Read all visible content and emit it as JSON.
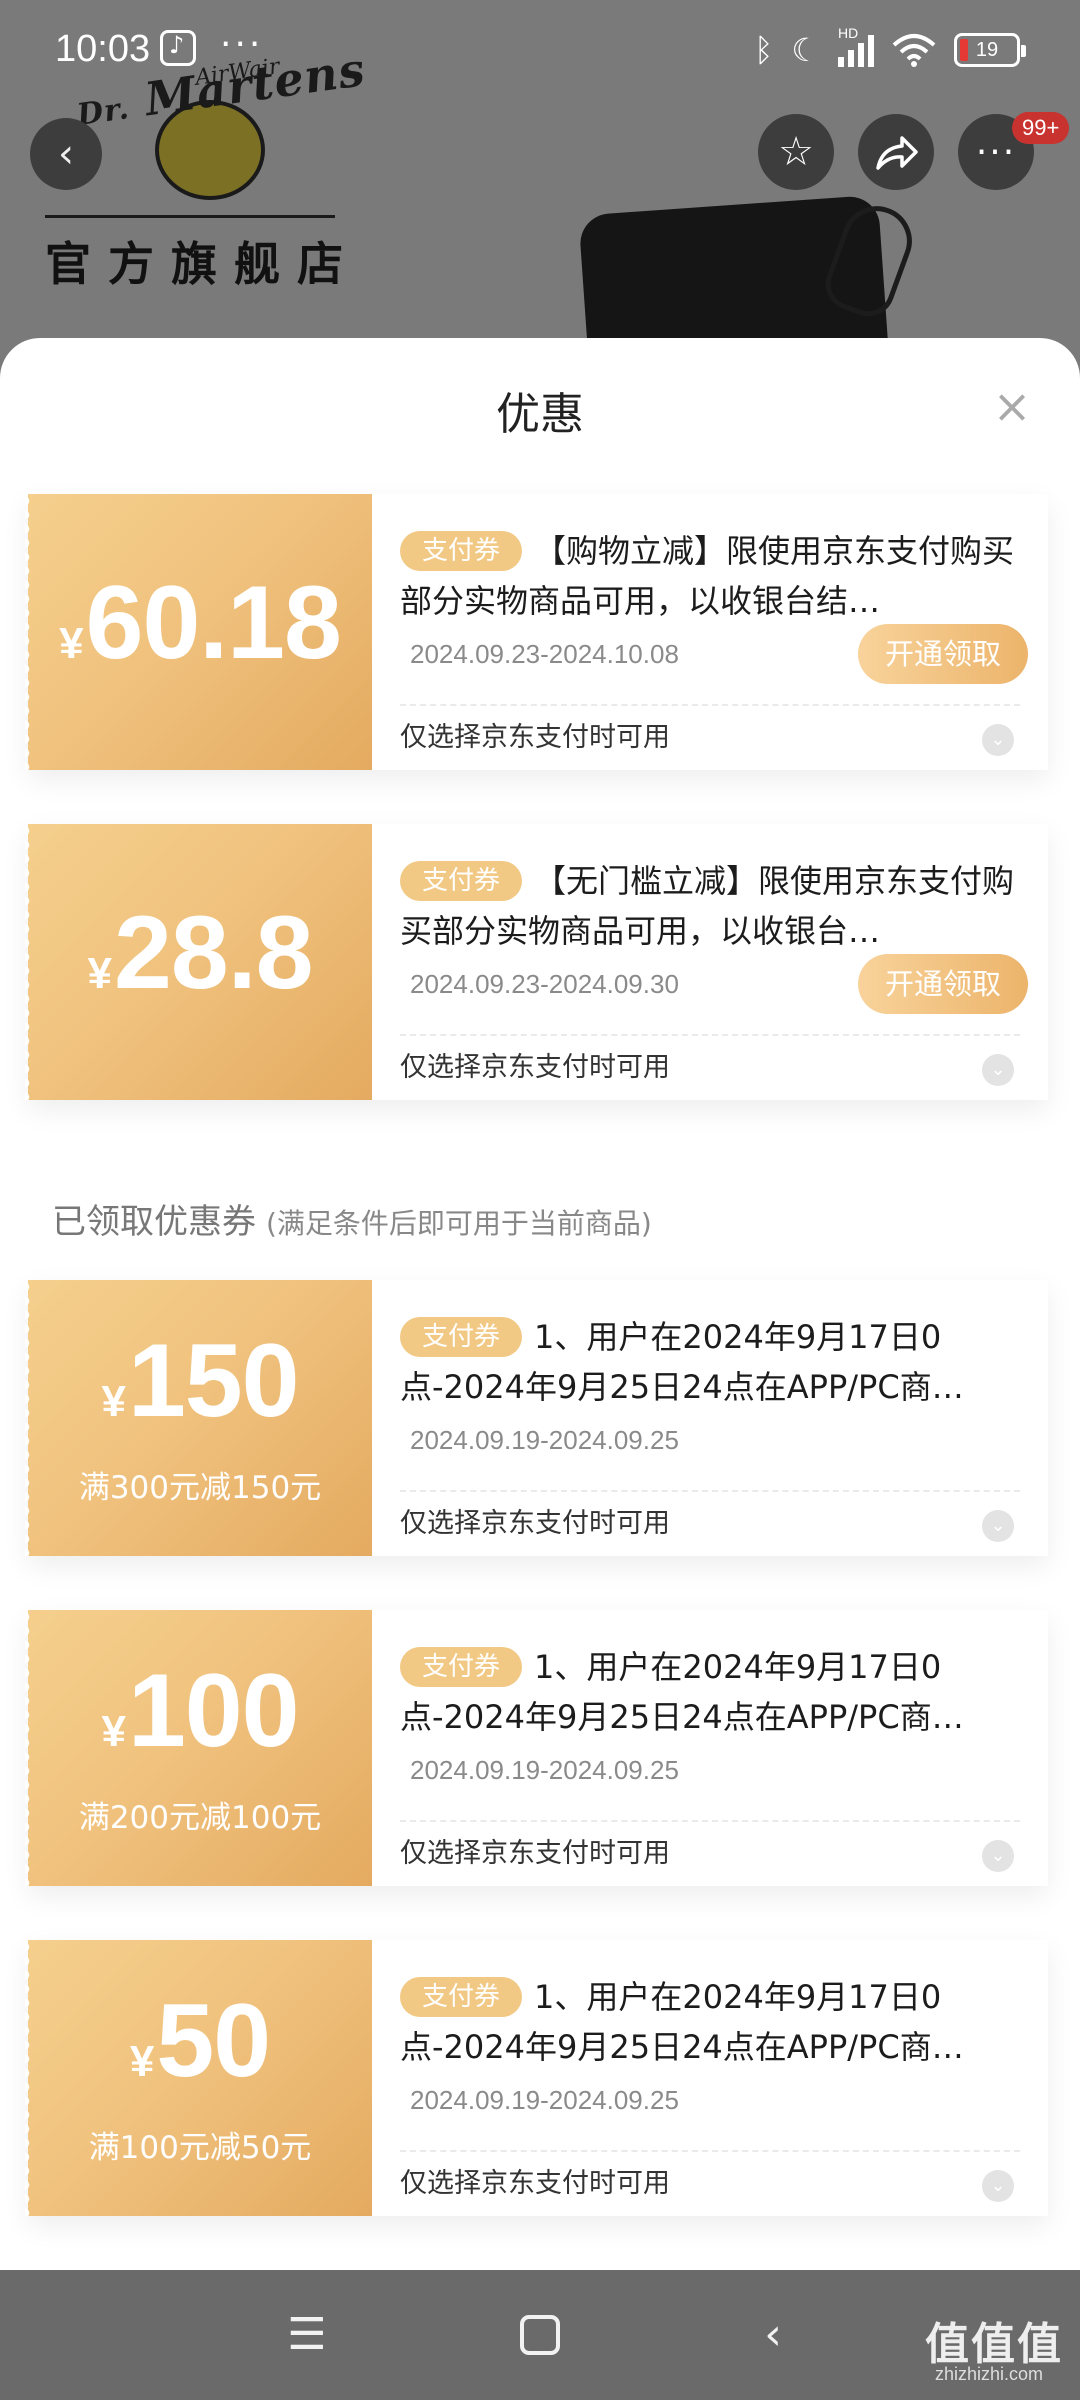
{
  "status_bar": {
    "time": "10:03",
    "dots": "···",
    "network_label": "HD",
    "battery_level": "19"
  },
  "store": {
    "logo_brand": "Martens",
    "logo_dr": "Dr.",
    "logo_airwair": "AirWair",
    "name": "官方旗舰店"
  },
  "header": {
    "back_icon": "chevron-left-icon",
    "favorite_icon": "star-icon",
    "share_icon": "share-icon",
    "more_icon": "more-icon",
    "message_badge": "99+"
  },
  "sheet": {
    "title": "优惠",
    "close_icon": "close-icon"
  },
  "available_coupons": [
    {
      "currency": "¥",
      "amount": "60.18",
      "tag": "支付券",
      "description": "【购物立减】限使用京东支付购买部分实物商品可用，以收银台结…",
      "date_range": "2024.09.23-2024.10.08",
      "button": "开通领取",
      "note": "仅选择京东支付时可用"
    },
    {
      "currency": "¥",
      "amount": "28.8",
      "tag": "支付券",
      "description": "【无门槛立减】限使用京东支付购买部分实物商品可用，以收银台…",
      "date_range": "2024.09.23-2024.09.30",
      "button": "开通领取",
      "note": "仅选择京东支付时可用"
    }
  ],
  "claimed_section": {
    "title": "已领取优惠券",
    "subtitle": "(满足条件后即可用于当前商品)"
  },
  "claimed_coupons": [
    {
      "currency": "¥",
      "amount": "150",
      "condition": "满300元减150元",
      "tag": "支付券",
      "description": "1、用户在2024年9月17日0点-2024年9月25日24点在APP/PC商…",
      "date_range": "2024.09.19-2024.09.25",
      "note": "仅选择京东支付时可用"
    },
    {
      "currency": "¥",
      "amount": "100",
      "condition": "满200元减100元",
      "tag": "支付券",
      "description": "1、用户在2024年9月17日0点-2024年9月25日24点在APP/PC商…",
      "date_range": "2024.09.19-2024.09.25",
      "note": "仅选择京东支付时可用"
    },
    {
      "currency": "¥",
      "amount": "50",
      "condition": "满100元减50元",
      "tag": "支付券",
      "description": "1、用户在2024年9月17日0点-2024年9月25日24点在APP/PC商…",
      "date_range": "2024.09.19-2024.09.25",
      "note": "仅选择京东支付时可用"
    }
  ],
  "nav_bar": {
    "menu_icon": "menu-icon",
    "home_icon": "home-square-icon",
    "back_icon": "back-triangle-icon"
  },
  "watermark": {
    "text": "值值值",
    "url": "zhizhizhi.com"
  },
  "colors": {
    "coupon_gold": "#f0c27e",
    "tag_gold": "#f2c984",
    "claim_button": "#ecb46b"
  }
}
